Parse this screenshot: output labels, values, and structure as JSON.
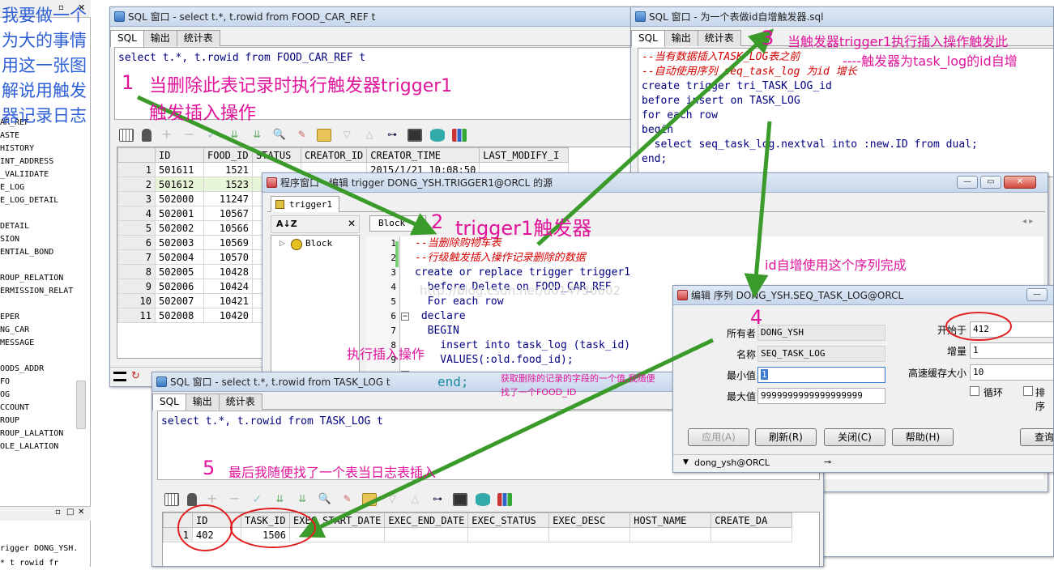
{
  "left_note": [
    "我要做一个",
    "为大的事情",
    "用这一张图",
    "解说用触发",
    "器记录日志"
  ],
  "left_panel_items": [
    "AR_REF",
    "ASTE",
    "HISTORY",
    "INT_ADDRESS",
    "_VALIIDATE",
    "E_LOG",
    "E_LOG_DETAIL",
    "",
    "DETAIL",
    "SION",
    "ENTIAL_BOND",
    "",
    "ROUP_RELATION",
    "ERMISSION_RELAT",
    "",
    "EPER",
    "NG_CAR",
    "MESSAGE",
    "",
    "OODS_ADDR",
    "FO",
    "OG",
    "CCOUNT",
    "ROUP",
    "ROUP_LALATION",
    "OLE_LALATION"
  ],
  "left_panel_bottom": "rigger DONG_YSH.",
  "left_panel_bottom2": "* t rowid fr",
  "win1": {
    "title": "SQL 窗口 - select t.*, t.rowid from FOOD_CAR_REF t",
    "tabs": [
      "SQL",
      "输出",
      "统计表"
    ],
    "sql": "select t.*, t.rowid from FOOD_CAR_REF t",
    "columns": [
      "",
      "ID",
      "FOOD_ID",
      "STATUS",
      "CREATOR_ID",
      "CREATOR_TIME",
      "LAST_MODIFY_I"
    ],
    "rows": [
      [
        "1",
        "501611",
        "1521"
      ],
      [
        "2",
        "501612",
        "1523"
      ],
      [
        "3",
        "502000",
        "11247"
      ],
      [
        "4",
        "502001",
        "10567"
      ],
      [
        "5",
        "502002",
        "10566"
      ],
      [
        "6",
        "502003",
        "10569"
      ],
      [
        "7",
        "502004",
        "10570"
      ],
      [
        "8",
        "502005",
        "10428"
      ],
      [
        "9",
        "502006",
        "10424"
      ],
      [
        "10",
        "502007",
        "10421"
      ],
      [
        "11",
        "502008",
        "10420"
      ]
    ],
    "first_creator_time": "2015/1/21 10:08:50"
  },
  "win2": {
    "title": "SQL 窗口 - 为一个表做id自增触发器.sql",
    "tabs": [
      "SQL",
      "输出",
      "统计表"
    ],
    "lines": [
      {
        "t": "--当有数据插入TASK_LOG表之前",
        "c": true
      },
      {
        "t": "--自动使用序列 seq_task_log 为id 增长",
        "c": true
      },
      {
        "t": "create trigger tri_TASK_LOG_id",
        "c": false
      },
      {
        "t": "before insert on TASK_LOG",
        "c": false
      },
      {
        "t": "for each row",
        "c": false
      },
      {
        "t": "begin",
        "c": false
      },
      {
        "t": "  select seq_task_log.nextval into :new.ID from dual;",
        "c": false
      },
      {
        "t": "end;",
        "c": false
      }
    ]
  },
  "win3": {
    "title": "程序窗口 - 编辑 trigger DONG_YSH.TRIGGER1@ORCL 的源",
    "tab": "trigger1",
    "sort_label": "A↓Z",
    "block_combo": "Block",
    "tree_item": "Block",
    "line_numbers": [
      "1",
      "2",
      "3",
      "4",
      "5",
      "6",
      "7",
      "8",
      "9"
    ],
    "lines": [
      {
        "t": "--当删除购物车表",
        "c": true
      },
      {
        "t": "--行级触发插入操作记录删除的数据",
        "c": true
      },
      {
        "t": "create or replace trigger trigger1",
        "c": false
      },
      {
        "t": "  before Delete on FOOD_CAR_REF",
        "c": false
      },
      {
        "t": "  For each row",
        "c": false
      },
      {
        "t": " declare",
        "c": false
      },
      {
        "t": "  BEGIN",
        "c": false
      },
      {
        "t": "    insert into task_log (task_id)",
        "c": false
      },
      {
        "t": "    VALUES(:old.food_id);",
        "c": false
      }
    ],
    "end_line": "end;",
    "watermark": "http://blog.csdn.net/u014730602"
  },
  "win4": {
    "title": "SQL 窗口 - select t.*, t.rowid from TASK_LOG t",
    "tabs": [
      "SQL",
      "输出",
      "统计表"
    ],
    "sql": "select t.*, t.rowid from TASK_LOG t",
    "columns": [
      "",
      "ID",
      "TASK_ID",
      "EXEC_START_DATE",
      "EXEC_END_DATE",
      "EXEC_STATUS",
      "EXEC_DESC",
      "HOST_NAME",
      "CREATE_DA"
    ],
    "row": [
      "1",
      "402",
      "1506"
    ]
  },
  "win5": {
    "title": "编辑 序列 DONG_YSH.SEQ_TASK_LOG@ORCL",
    "labels": {
      "owner": "所有者",
      "name": "名称",
      "min": "最小值",
      "max": "最大值",
      "start": "开始于",
      "incr": "增量",
      "cache": "高速缓存大小",
      "cycle": "循环",
      "order": "排序"
    },
    "values": {
      "owner": "DONG_YSH",
      "name": "SEQ_TASK_LOG",
      "min": "1",
      "max": "9999999999999999999",
      "start": "412",
      "incr": "1",
      "cache": "10"
    },
    "buttons": [
      "应用(A)",
      "刷新(R)",
      "关闭(C)",
      "帮助(H)",
      "查询"
    ],
    "status": "dong_ysh@ORCL"
  },
  "annotations": {
    "a1_num": "1",
    "a1_line1": "当删除此表记录时执行触发器trigger1",
    "a1_line2": "触发插入操作",
    "a2_num": "2",
    "a2": "trigger1触发器",
    "a3_num": "3",
    "a3_line1": "当触发器trigger1执行插入操作触发此",
    "a3_line2": "----触发器为task_log的id自增",
    "a_seq": "id自增使用这个序列完成",
    "a4_num": "4",
    "a_insert": "执行插入操作",
    "a_note_line1": "获取删除的记录的字段的一个值,我随便",
    "a_note_line2": "找了一个FOOD_ID",
    "a5_num": "5",
    "a5": "最后我随便找了一个表当日志表插入"
  },
  "colors": {
    "annotation": "#e0139b",
    "arrow": "#3a9a2a",
    "circle": "#e02020",
    "comment": "#d40000",
    "keyword": "#000080"
  }
}
